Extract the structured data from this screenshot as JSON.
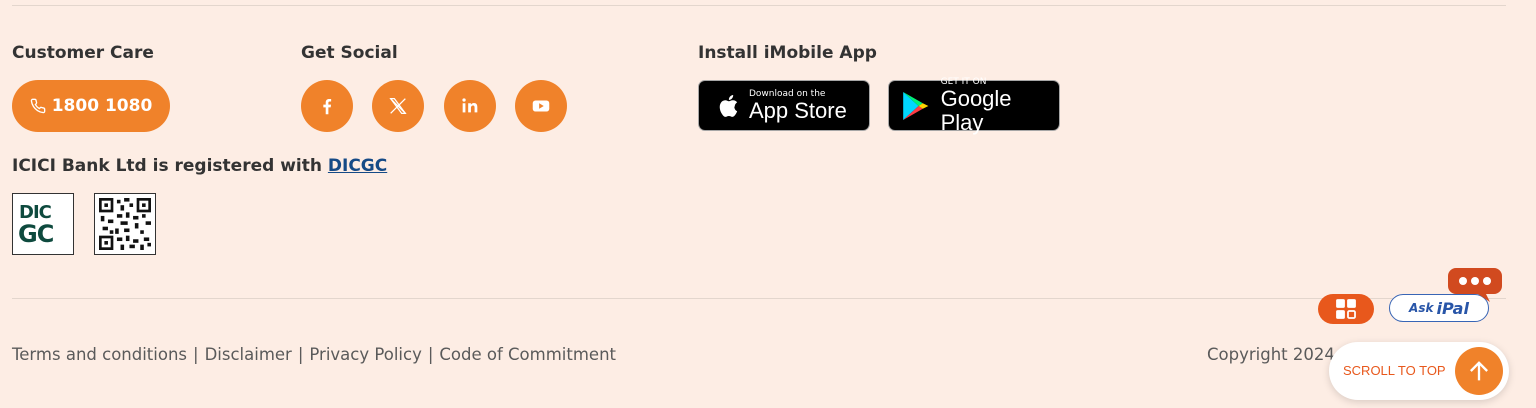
{
  "customer_care": {
    "heading": "Customer Care",
    "phone": "1800 1080"
  },
  "social": {
    "heading": "Get Social",
    "items": [
      "facebook-icon",
      "x-twitter-icon",
      "linkedin-icon",
      "youtube-icon"
    ]
  },
  "app": {
    "heading": "Install iMobile App",
    "app_store": {
      "small": "Download on the",
      "large": "App Store"
    },
    "google_play": {
      "small": "GET IT ON",
      "large": "Google Play"
    }
  },
  "dicgc": {
    "text": "ICICI Bank Ltd is registered with ",
    "link": "DICGC",
    "logo_top": "DIC",
    "logo_bottom": "GC"
  },
  "footer": {
    "links": [
      "Terms and conditions",
      "Disclaimer",
      "Privacy Policy",
      "Code of Commitment"
    ],
    "separator": "|",
    "copyright": "Copyright 2024"
  },
  "widgets": {
    "ask_prefix": "Ask",
    "ask_name": "iPal",
    "scroll_top": "SCROLL TO TOP"
  },
  "colors": {
    "accent": "#f0822a",
    "background": "#fdede4",
    "link": "#154a86"
  }
}
